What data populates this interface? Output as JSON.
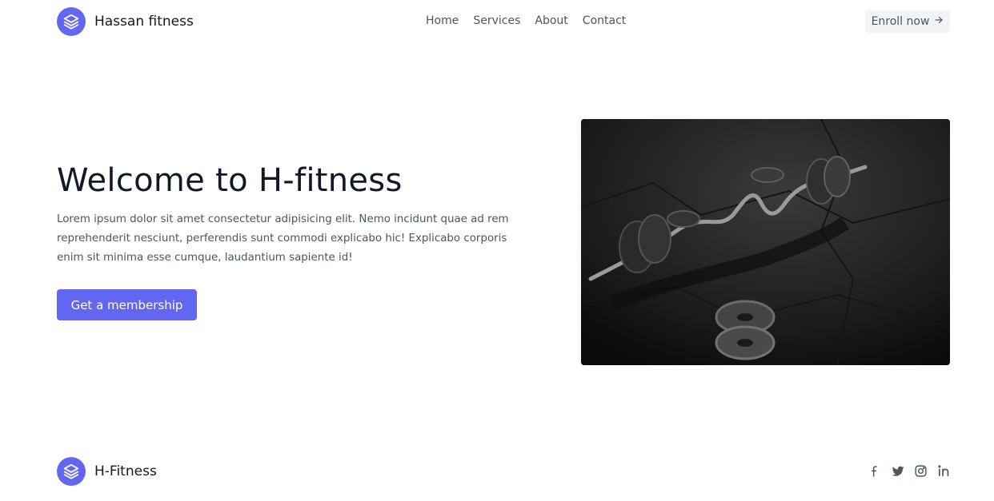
{
  "header": {
    "brand_name": "Hassan fitness",
    "logo_icon": "layers-icon",
    "nav": [
      {
        "label": "Home"
      },
      {
        "label": "Services"
      },
      {
        "label": "About"
      },
      {
        "label": "Contact"
      }
    ],
    "enroll_label": "Enroll now"
  },
  "hero": {
    "title": "Welcome to H-fitness",
    "text": "Lorem ipsum dolor sit amet consectetur adipisicing elit. Nemo incidunt quae ad rem reprehenderit nesciunt, perferendis sunt commodi explicabo hic! Explicabo corporis enim sit minima esse cumque, laudantium sapiente id!",
    "cta_label": "Get a membership",
    "image_icon": "barbell-photo"
  },
  "footer": {
    "brand_name": "H-Fitness",
    "social_icons": [
      "facebook-icon",
      "twitter-icon",
      "instagram-icon",
      "linkedin-icon"
    ]
  },
  "colors": {
    "accent": "#6366f1",
    "text_dark": "#111827",
    "text_muted": "#4b5563",
    "button_gray": "#f3f4f6"
  }
}
